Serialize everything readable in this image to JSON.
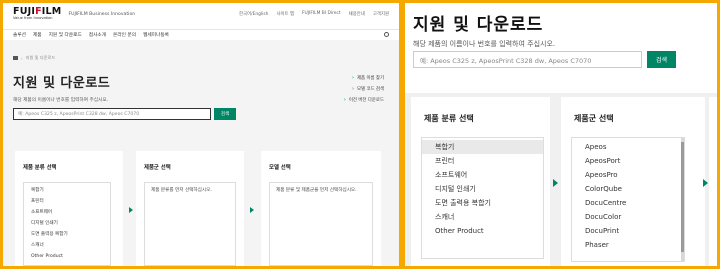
{
  "colors": {
    "frame": "#f5a800",
    "accent_green": "#008565",
    "logo_red": "#c8102e"
  },
  "left": {
    "logo": {
      "word_a": "FUJI",
      "word_x": "F",
      "word_b": "ILM",
      "tagline": "Value from Innovation",
      "sub": "FUJIFILM Business Innovation"
    },
    "util_links": [
      "한국어/English",
      "사이트 맵",
      "FUJIFILM BI Direct",
      "채용안내",
      "고객지원"
    ],
    "nav": [
      "솔루션",
      "제품",
      "지원 및 다운로드",
      "접사소개",
      "온라인 문의",
      "웹세미나등록"
    ],
    "breadcrumb": "지원 및 다운로드",
    "title": "지원 및 다운로드",
    "desc": "해당 제품의 이름이나 번호를 입력하여 주십시오.",
    "search_placeholder": "예: Apeos C325 z, ApeosPrint C328 dw, Apeos C7070",
    "search_button": "검색",
    "quick_links": [
      "제품 이름 찾기",
      "모델 코드 검색",
      "이전 버전 다운로드"
    ],
    "cards": [
      {
        "title": "제품 분류 선택",
        "items": [
          "복합기",
          "프린터",
          "소프트웨어",
          "디지털 인쇄기",
          "도면 출력용 복합기",
          "스캐너",
          "Other Product"
        ]
      },
      {
        "title": "제품군 선택",
        "placeholder": "제품 분류를 먼저 선택하십시오."
      },
      {
        "title": "모델 선택",
        "placeholder": "제품 분류 및 제품군을 먼저 선택하십시오."
      }
    ]
  },
  "right": {
    "title": "지원 및 다운로드",
    "desc": "해당 제품의 이름이나 번호를 입력하여 주십시오.",
    "search_placeholder": "예: Apeos C325 z, ApeosPrint C328 dw, Apeos C7070",
    "search_button": "검색",
    "cards": [
      {
        "title": "제품 분류 선택",
        "items": [
          "복합기",
          "프린터",
          "소프트웨어",
          "디지털 인쇄기",
          "도면 출력용 복합기",
          "스캐너",
          "Other Product"
        ]
      },
      {
        "title": "제품군 선택",
        "items": [
          "Apeos",
          "ApeosPort",
          "ApeosPro",
          "ColorQube",
          "DocuCentre",
          "DocuColor",
          "DocuPrint",
          "Phaser"
        ]
      }
    ]
  }
}
